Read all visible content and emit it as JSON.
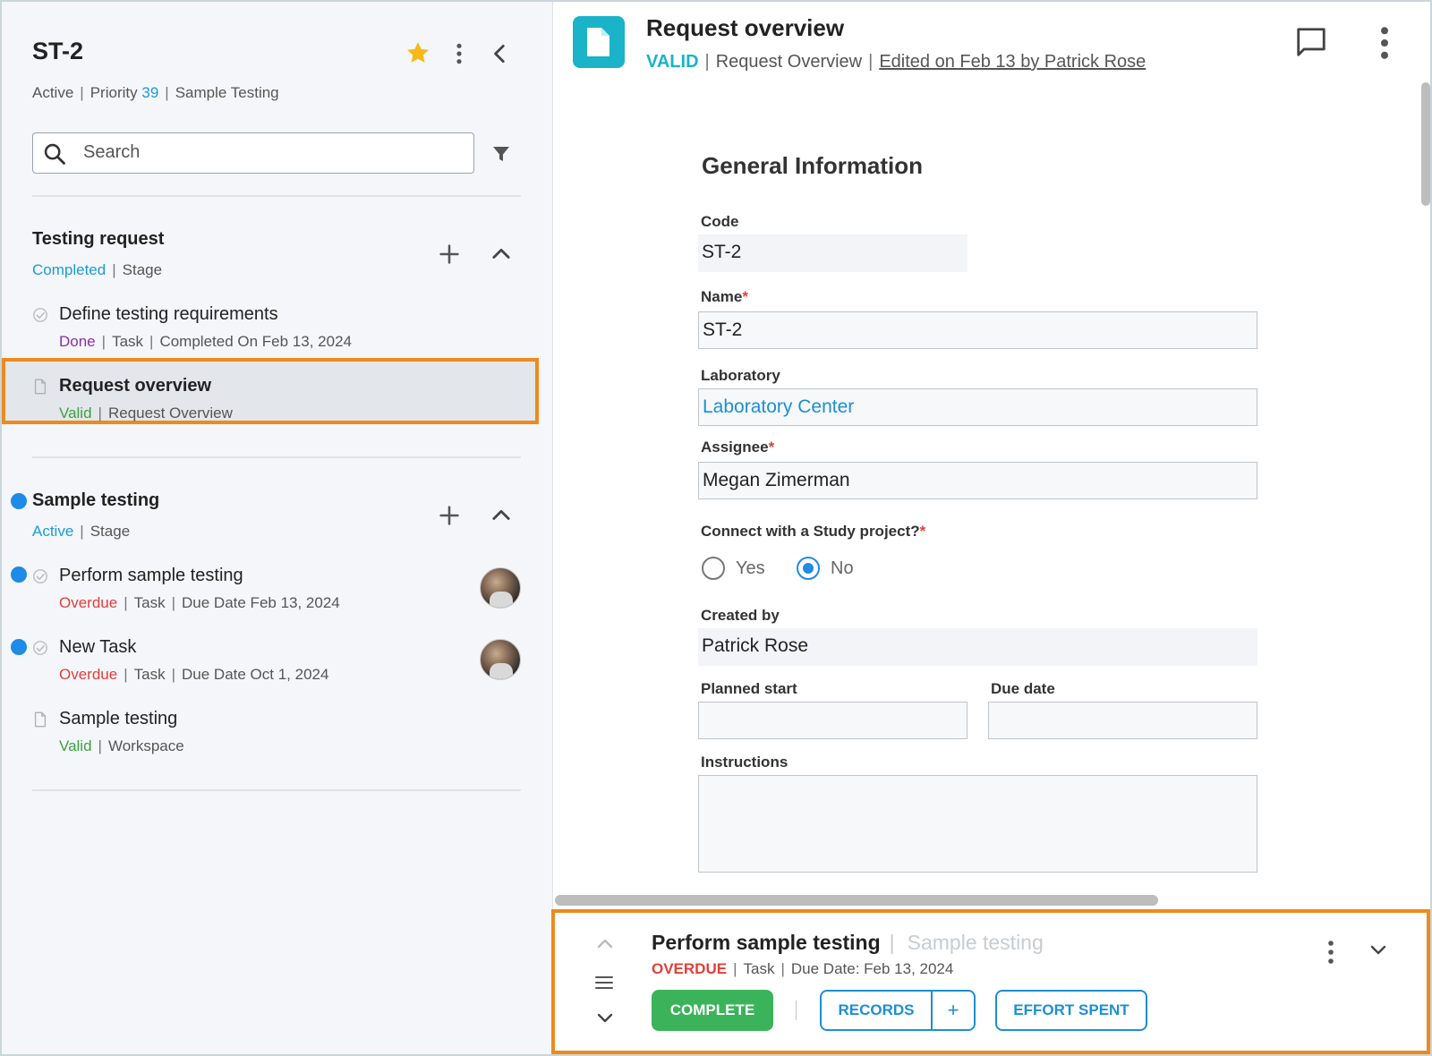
{
  "sidebar": {
    "title": "ST-2",
    "meta": {
      "status": "Active",
      "priority_label": "Priority",
      "priority_value": "39",
      "workspace": "Sample Testing"
    },
    "search": {
      "placeholder": "Search"
    },
    "sections": [
      {
        "title": "Testing request",
        "status": "Completed",
        "type": "Stage",
        "items": [
          {
            "title": "Define testing requirements",
            "status": "Done",
            "type": "Task",
            "detail": "Completed On Feb 13, 2024"
          },
          {
            "title": "Request overview",
            "status": "Valid",
            "type": "Request Overview"
          }
        ]
      },
      {
        "title": "Sample testing",
        "status": "Active",
        "type": "Stage",
        "items": [
          {
            "title": "Perform sample testing",
            "status": "Overdue",
            "type": "Task",
            "detail": "Due Date Feb 13, 2024"
          },
          {
            "title": "New Task",
            "status": "Overdue",
            "type": "Task",
            "detail": "Due Date Oct 1, 2024"
          },
          {
            "title": "Sample testing",
            "status": "Valid",
            "type": "Workspace"
          }
        ]
      }
    ]
  },
  "header": {
    "title": "Request overview",
    "status": "VALID",
    "type": "Request Overview",
    "edited": "Edited on Feb 13 by Patrick Rose"
  },
  "form": {
    "heading": "General Information",
    "code": {
      "label": "Code",
      "value": "ST-2"
    },
    "name": {
      "label": "Name",
      "value": "ST-2",
      "required_mark": "*"
    },
    "laboratory": {
      "label": "Laboratory",
      "value": "Laboratory Center"
    },
    "assignee": {
      "label": "Assignee",
      "value": "Megan Zimerman",
      "required_mark": "*"
    },
    "connect": {
      "label": "Connect with a Study project?",
      "required_mark": "*",
      "options": [
        "Yes",
        "No"
      ],
      "selected": "No"
    },
    "created_by": {
      "label": "Created by",
      "value": "Patrick Rose"
    },
    "planned_start": {
      "label": "Planned start",
      "value": ""
    },
    "due_date": {
      "label": "Due date",
      "value": ""
    },
    "instructions": {
      "label": "Instructions",
      "value": ""
    }
  },
  "taskbar": {
    "title": "Perform sample testing",
    "context": "Sample testing",
    "status": "OVERDUE",
    "type": "Task",
    "due": "Due Date: Feb 13, 2024",
    "buttons": {
      "complete": "COMPLETE",
      "records": "RECORDS",
      "plus": "+",
      "effort": "EFFORT SPENT"
    }
  },
  "icons": {
    "favorite": "star-icon",
    "more": "kebab-icon",
    "back": "chevron-left-icon",
    "search": "search-icon",
    "filter": "filter-icon",
    "add": "plus-icon",
    "collapse": "chevron-up-icon",
    "task_status": "check-circle-icon",
    "document": "document-icon",
    "comments": "chat-bubble-icon"
  },
  "colors": {
    "accent": "#1c9ad6",
    "teal": "#1ab3c8",
    "done": "#8b2fa8",
    "valid": "#3aa33f",
    "overdue": "#e0403a",
    "complete_button": "#3bb35a",
    "highlight": "#ee8a1d",
    "star": "#f6b81a"
  },
  "separator": "|"
}
